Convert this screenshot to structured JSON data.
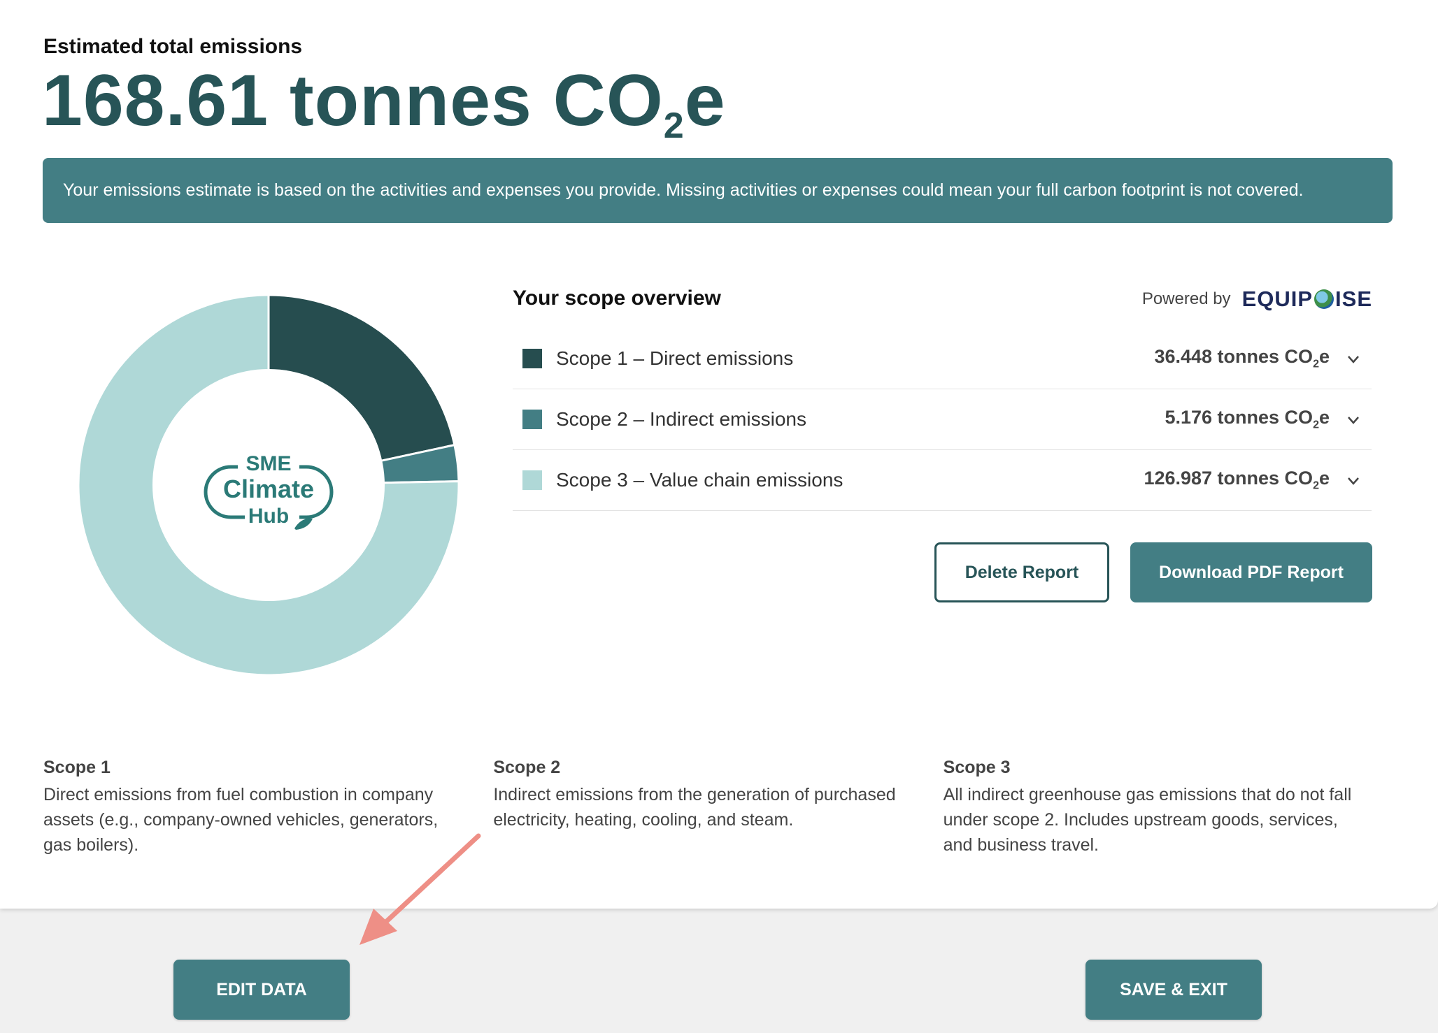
{
  "header": {
    "kicker": "Estimated total emissions",
    "total_value": "168.61 tonnes CO",
    "total_sub": "2",
    "total_suffix": "e"
  },
  "banner": {
    "text": "Your emissions estimate is based on the activities and expenses you provide. Missing activities or expenses could mean your full carbon footprint is not covered."
  },
  "logo": {
    "line1": "SME",
    "line2": "Climate",
    "line3": "Hub"
  },
  "overview": {
    "title": "Your scope overview",
    "powered_label": "Powered by",
    "brand_left": "EQUIP",
    "brand_right": "ISE",
    "brand_globe_icon": "globe-icon"
  },
  "scopes": [
    {
      "name": "Scope 1 – Direct emissions",
      "value": "36.448 tonnes CO",
      "sub": "2",
      "suffix": "e",
      "color": "#264d4f"
    },
    {
      "name": "Scope 2 – Indirect emissions",
      "value": "5.176 tonnes CO",
      "sub": "2",
      "suffix": "e",
      "color": "#437e84"
    },
    {
      "name": "Scope 3 – Value chain emissions",
      "value": "126.987 tonnes CO",
      "sub": "2",
      "suffix": "e",
      "color": "#afd8d7"
    }
  ],
  "actions": {
    "delete_label": "Delete Report",
    "download_label": "Download PDF Report"
  },
  "definitions": [
    {
      "title": "Scope 1",
      "text": "Direct emissions from fuel combustion in company assets (e.g., company-owned vehicles, generators, gas boilers)."
    },
    {
      "title": "Scope 2",
      "text": "Indirect emissions from the generation of purchased electricity, heating, cooling, and steam."
    },
    {
      "title": "Scope 3",
      "text": "All indirect greenhouse gas emissions that do not fall under scope 2. Includes upstream goods, services, and business travel."
    }
  ],
  "footer": {
    "edit_label": "EDIT DATA",
    "save_label": "SAVE & EXIT"
  },
  "chart_data": {
    "type": "pie",
    "variant": "donut",
    "categories": [
      "Scope 1 – Direct emissions",
      "Scope 2 – Indirect emissions",
      "Scope 3 – Value chain emissions"
    ],
    "values": [
      36.448,
      5.176,
      126.987
    ],
    "colors": [
      "#264d4f",
      "#437e84",
      "#afd8d7"
    ],
    "start_angle_deg": 0,
    "direction": "clockwise",
    "legend": "right"
  },
  "colors": {
    "accent": "#437e84",
    "dark": "#275457",
    "arrow": "#ee8f86"
  }
}
